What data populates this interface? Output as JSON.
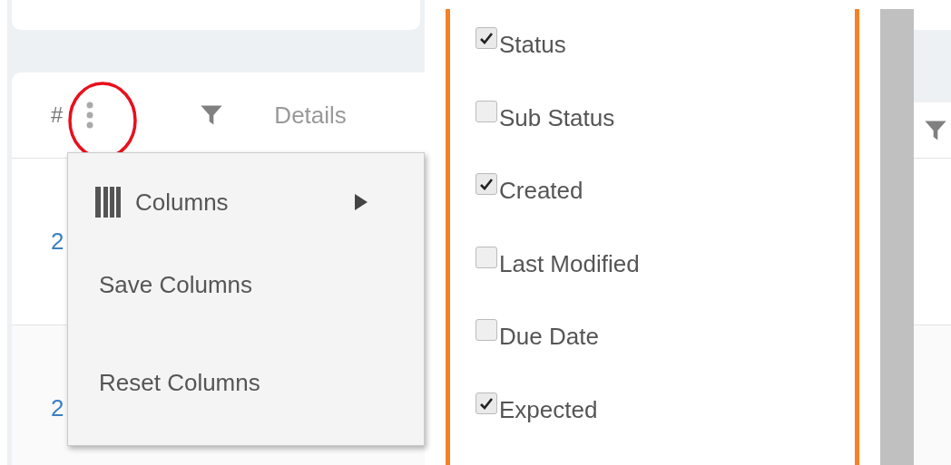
{
  "table": {
    "header": {
      "number_label": "#",
      "details_label": "Details"
    },
    "rows": [
      {
        "id_cell": "2"
      },
      {
        "id_cell": "2"
      }
    ]
  },
  "menu": {
    "items": [
      {
        "kind": "submenu",
        "label": "Columns"
      },
      {
        "kind": "action",
        "label": "Save Columns"
      },
      {
        "kind": "action",
        "label": "Reset Columns"
      }
    ]
  },
  "column_picker": {
    "options": [
      {
        "label": "Status",
        "checked": true
      },
      {
        "label": "Sub Status",
        "checked": false
      },
      {
        "label": "Created",
        "checked": true
      },
      {
        "label": "Last Modified",
        "checked": false
      },
      {
        "label": "Due Date",
        "checked": false
      },
      {
        "label": "Expected",
        "checked": true
      }
    ]
  }
}
